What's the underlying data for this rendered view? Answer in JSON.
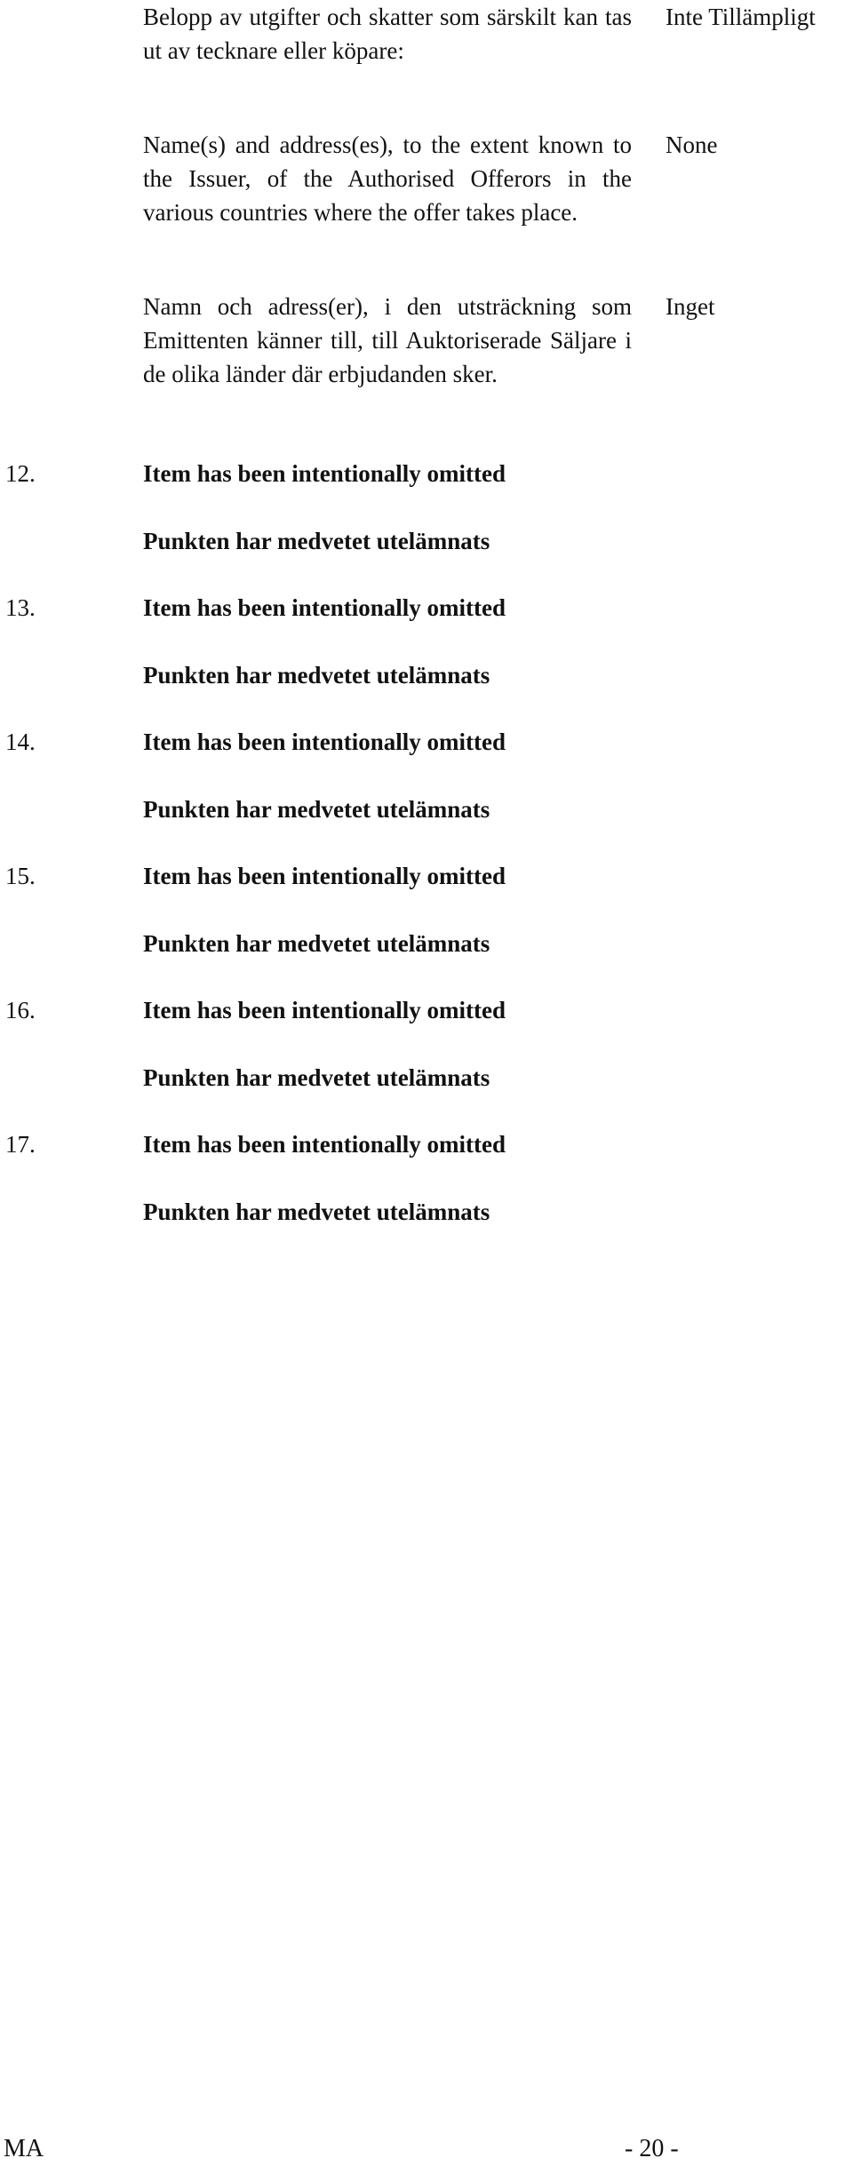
{
  "rows": [
    {
      "left": "Belopp av utgifter och skatter som särskilt kan tas ut av tecknare eller köpare:",
      "right": "Inte Tillämpligt"
    },
    {
      "left": "Name(s) and address(es), to the extent known to the Issuer, of the Authorised Offerors in the various countries where the offer takes place.",
      "right": "None"
    },
    {
      "left": "Namn och adress(er), i den utsträckning som Emittenten känner till, till Auktoriserade Säljare i de olika länder där erbjudanden sker.",
      "right": "Inget"
    }
  ],
  "items": [
    {
      "number": "12.",
      "title": "Item has been intentionally omitted",
      "subtitle": "Punkten har medvetet utelämnats"
    },
    {
      "number": "13.",
      "title": "Item has been intentionally omitted",
      "subtitle": "Punkten har medvetet utelämnats"
    },
    {
      "number": "14.",
      "title": "Item has been intentionally omitted",
      "subtitle": "Punkten har medvetet utelämnats"
    },
    {
      "number": "15.",
      "title": "Item has been intentionally omitted",
      "subtitle": "Punkten har medvetet utelämnats"
    },
    {
      "number": "16.",
      "title": "Item has been intentionally omitted",
      "subtitle": "Punkten har medvetet utelämnats"
    },
    {
      "number": "17.",
      "title": "Item has been intentionally omitted",
      "subtitle": "Punkten har medvetet utelämnats"
    }
  ],
  "footer": {
    "left": "MA",
    "page": "- 20 -"
  }
}
